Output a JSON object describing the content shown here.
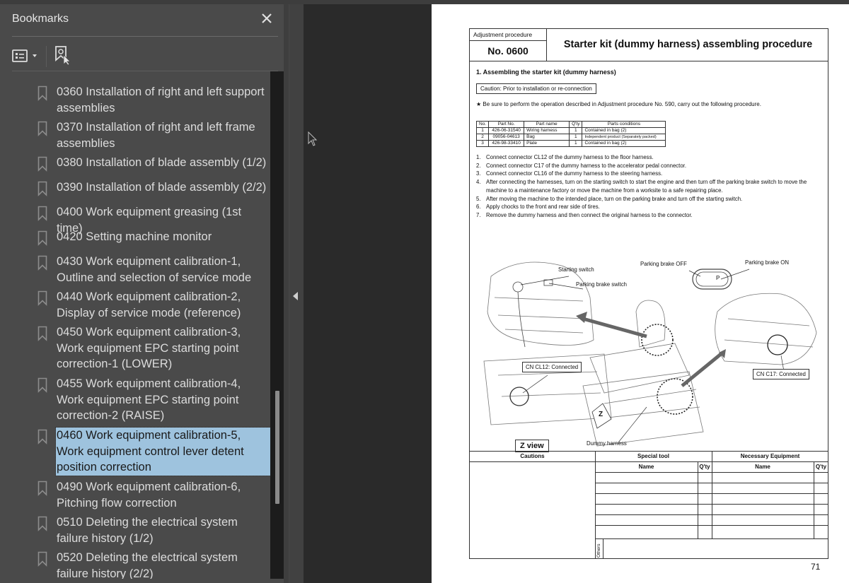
{
  "sidebar": {
    "title": "Bookmarks",
    "close_icon": "close-icon",
    "tools": {
      "options_icon": "list-options-icon",
      "options_dropdown_icon": "chevron-down-icon",
      "find_icon": "find-current-bookmark-icon"
    },
    "items": [
      {
        "label": "0360  Installation of right and left support assemblies",
        "selected": false
      },
      {
        "label": "0370  Installation of right and left frame assemblies",
        "selected": false
      },
      {
        "label": "0380  Installation of blade assembly (1/2)",
        "selected": false
      },
      {
        "label": "0390  Installation of blade assembly (2/2)",
        "selected": false
      },
      {
        "label": "0400  Work equipment greasing (1st time)",
        "selected": false
      },
      {
        "label": "0420  Setting machine monitor",
        "selected": false
      },
      {
        "label": "0430  Work equipment calibration-1, Outline and selection of service mode",
        "selected": false
      },
      {
        "label": "0440  Work equipment calibration-2, Display of service mode (reference)",
        "selected": false
      },
      {
        "label": "0450  Work equipment calibration-3, Work equipment EPC starting point correction-1 (LOWER)",
        "selected": false
      },
      {
        "label": "0455  Work equipment calibration-4, Work equipment EPC starting point correction-2 (RAISE)",
        "selected": false
      },
      {
        "label": "0460  Work equipment calibration-5, Work equipment control lever detent position correction",
        "selected": true
      },
      {
        "label": "0490  Work equipment calibration-6, Pitching flow correction",
        "selected": false
      },
      {
        "label": "0510  Deleting the electrical system failure history (1/2)",
        "selected": false
      },
      {
        "label": "0520  Deleting the electrical system failure history (2/2)",
        "selected": false
      }
    ]
  },
  "document": {
    "header": {
      "category": "Adjustment procedure",
      "number": "No. 0600",
      "title": "Starter kit (dummy harness) assembling procedure"
    },
    "section_title": "1.  Assembling the starter kit (dummy harness)",
    "caution": "Caution: Prior to installation or re-connection",
    "note": "★  Be sure to perform the operation described in Adjustment procedure No. 590, carry out the following procedure.",
    "parts_table": {
      "headers": [
        "No.",
        "Part No.",
        "Part name",
        "Q'ty",
        "Parts conditions"
      ],
      "rows": [
        [
          "1",
          "426-06-31540",
          "Wiring harness",
          "1",
          "Contained in bag (2)"
        ],
        [
          "2",
          "09056-04613",
          "Bag",
          "1",
          "Independent product (Separately packed)"
        ],
        [
          "3",
          "426-98-33410",
          "Plate",
          "1",
          "Contained in bag (2)"
        ]
      ]
    },
    "steps": [
      {
        "num": "1.",
        "text": "Connect connector CL12 of the dummy harness to the floor harness."
      },
      {
        "num": "2.",
        "text": "Connect connector C17 of the dummy harness to the accelerator pedal connector."
      },
      {
        "num": "3.",
        "text": "Connect connector CL16 of the dummy harness to the steering harness."
      },
      {
        "num": "4.",
        "text": "After connecting the harnesses, turn on the starting switch to start the engine and then turn off the parking brake switch to move the machine to a maintenance factory or move the machine from a worksite to a safe repairing place."
      },
      {
        "num": "5.",
        "text": "After moving the machine to the intended place, turn on the parking brake and turn off the starting switch."
      },
      {
        "num": "6.",
        "text": "Apply chocks to the front and rear side of tires."
      },
      {
        "num": "7.",
        "text": "Remove the dummy harness and then connect the original harness to the connector."
      }
    ],
    "figure": {
      "starting_switch": "Starting switch",
      "parking_brake_switch": "Parking brake switch",
      "parking_brake_off": "Parking brake OFF",
      "parking_brake_on": "Parking brake ON",
      "switch_glyph": "P",
      "cn_cl12": "CN CL12: Connected",
      "cn_c17": "CN C17: Connected",
      "z_marker": "Z",
      "z_view": "Z view",
      "dummy_harness": "Dummy harness"
    },
    "bottom_table": {
      "cautions": "Cautions",
      "special_tool": "Special tool",
      "necessary_equipment": "Necessary Equipment",
      "name": "Name",
      "qty": "Q'ty",
      "others": "Others"
    },
    "page_number": "71"
  }
}
